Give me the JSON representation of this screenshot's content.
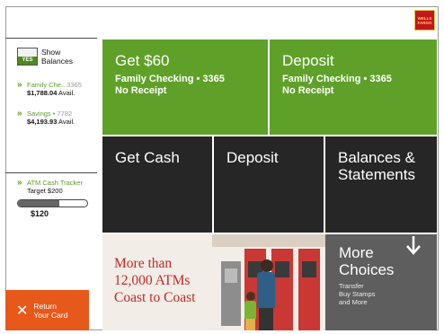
{
  "brand": {
    "logo_text": "WELLS FARGO",
    "accent_green": "#5fa128",
    "accent_orange": "#e6591b"
  },
  "sidebar": {
    "balances_toggle": {
      "state": "YES",
      "label_line1": "Show",
      "label_line2": "Balances"
    },
    "accounts": [
      {
        "name": "Family Che...",
        "number": "3365",
        "balance": "$1,788.04",
        "suffix": "Avail."
      },
      {
        "name": "Savings",
        "number": "7782",
        "balance": "$4,193.93",
        "suffix": "Avail."
      }
    ],
    "cash_tracker": {
      "title": "ATM Cash Tracker",
      "target": "Target $200",
      "amount": "$120",
      "progress": 0.6
    },
    "return_card": {
      "line1": "Return",
      "line2": "Your Card"
    }
  },
  "tiles": {
    "fast_cash": {
      "title": "Get $60",
      "account": "Family Checking • 3365",
      "note": "No Receipt"
    },
    "fast_deposit": {
      "title": "Deposit",
      "account": "Family Checking • 3365",
      "note": "No Receipt"
    },
    "get_cash": {
      "title": "Get Cash"
    },
    "deposit": {
      "title": "Deposit"
    },
    "balances": {
      "title_line1": "Balances &",
      "title_line2": "Statements"
    }
  },
  "promo": {
    "line1": "More than",
    "line2": "12,000 ATMs",
    "line3": "Coast to Coast"
  },
  "more_choices": {
    "line1": "More",
    "line2": "Choices",
    "items": [
      "Transfer",
      "Buy Stamps",
      "and More"
    ]
  }
}
